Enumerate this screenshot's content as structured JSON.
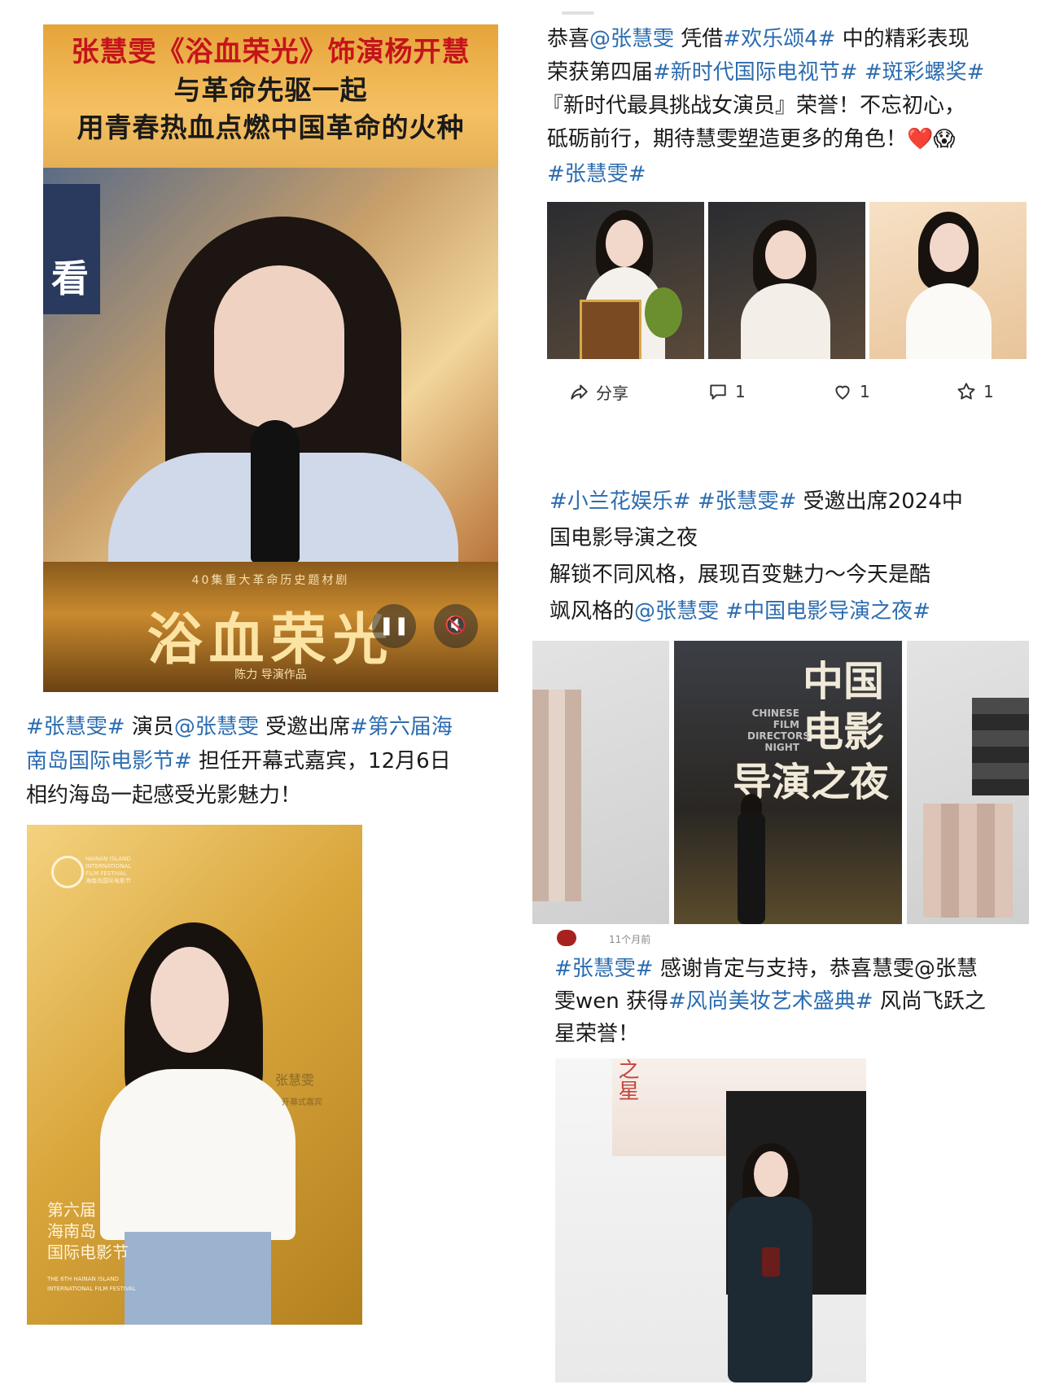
{
  "video": {
    "title_line1": "张慧雯《浴血荣光》饰演杨开慧",
    "title_line2": "与革命先驱一起",
    "title_line3": "用青春热血点燃中国革命的火种",
    "bg_sign": "看",
    "banner_subtitle": "40集重大革命历史题材剧",
    "banner_title": "浴血荣光",
    "banner_director": "陈力 导演作品",
    "pause_icon": "pause-icon",
    "mute_icon": "mute-icon"
  },
  "post1": {
    "segments": [
      [
        "恭喜",
        "@张慧雯",
        " 凭借",
        "#欢乐颂4#",
        " 中的精彩表现"
      ],
      [
        "荣获第四届",
        "#新时代国际电视节#",
        " ",
        "#斑彩螺奖#"
      ],
      [
        "『新时代最具挑战女演员』荣誉！不忘初心，"
      ],
      [
        "砥砺前行，期待慧雯塑造更多的角色！",
        "❤️",
        "😱"
      ],
      [
        "#张慧雯#"
      ]
    ],
    "actions": {
      "share_label": "分享",
      "comment_count": "1",
      "like_count": "1",
      "star_count": "1"
    }
  },
  "post2": {
    "line1_tag": "#张慧雯#",
    "line1_a": " 演员",
    "line1_mention": "@张慧雯",
    "line1_b": " 受邀出席",
    "line1_tag2": "#第六届海",
    "line2_tag": "南岛国际电影节#",
    "line2_b": " 担任开幕式嘉宾，12月6日",
    "line3": "相约海岛一起感受光影魅力！"
  },
  "poster": {
    "logo_line1": "HAINAN ISLAND",
    "logo_line2": "INTERNATIONAL",
    "logo_line3": "FILM FESTIVAL",
    "logo_line4": "海南岛国际电影节",
    "name": "张慧雯",
    "role": "开幕式嘉宾",
    "fest_line1": "第六届",
    "fest_line2": "海南岛",
    "fest_line3": "国际电影节",
    "fest_en1": "THE 6TH HAINAN ISLAND",
    "fest_en2": "INTERNATIONAL FILM FESTIVAL"
  },
  "post3": {
    "line1_tag": "#小兰花娱乐#",
    "line1_tag2": "#张慧雯#",
    "line1_b": " 受邀出席2024中",
    "line2": "国电影导演之夜",
    "line3": "解锁不同风格，展现百变魅力～今天是酷",
    "line4_a": "飒风格的",
    "line4_mention": "@张慧雯",
    "line4_tag": " #中国电影导演之夜#",
    "night_cn1": "中国",
    "night_cn2": "电影",
    "night_cn3": "导演之夜",
    "night_en1": "CHINESE",
    "night_en2": "FILM",
    "night_en3": "DIRECTORS'",
    "night_en4": "NIGHT"
  },
  "post4": {
    "header_time": "11个月前",
    "line1_tag": "#张慧雯#",
    "line1_b": " 感谢肯定与支持，恭喜慧雯@张慧",
    "line2_a": "雯wen 获得",
    "line2_tag": "#风尚美妆艺术盛典#",
    "line2_b": " 风尚飞跃之",
    "line3": "星荣誉！",
    "photo_text": "之星"
  },
  "colors": {
    "hashtag": "#2b6cb0",
    "title_red": "#c4141b",
    "gold": "#d9a63c"
  }
}
